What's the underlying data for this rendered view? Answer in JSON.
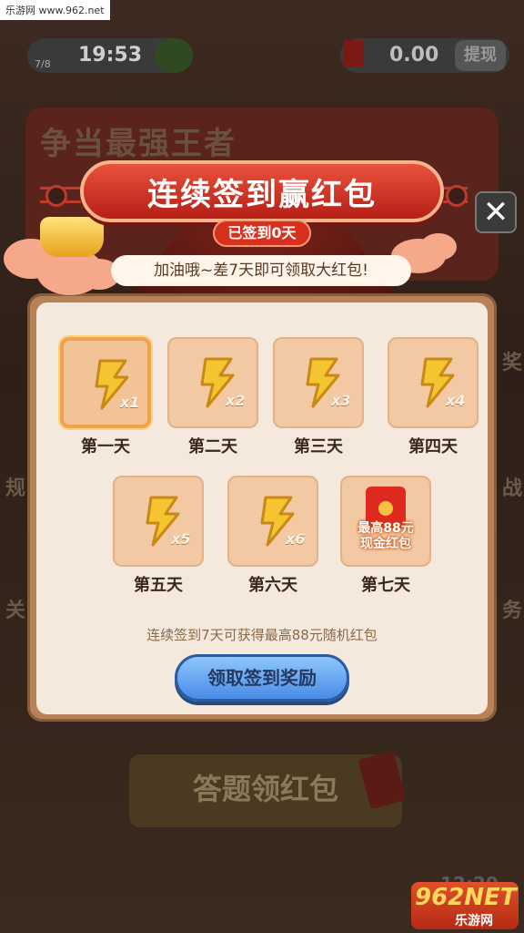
{
  "watermark": "乐游网 www.962.net",
  "topbar": {
    "energy_count": "7/8",
    "timer": "19:53",
    "plus_label": "+",
    "balance": "0.00",
    "withdraw_label": "提现"
  },
  "background": {
    "banner_title": "争当最强王者",
    "quiz_button_label": "答题领红包",
    "side_left_1": "规",
    "side_left_2": "关",
    "side_right_1": "奖",
    "side_right_2": "战",
    "side_right_3": "务",
    "bottom_number": "12:20"
  },
  "modal": {
    "title": "连续签到赢红包",
    "streak_badge": "已签到0天",
    "tip": "加油哦~差7天即可领取大红包!",
    "close_label": "✕",
    "days": [
      {
        "label": "第一天",
        "multiplier": "x1",
        "active": true
      },
      {
        "label": "第二天",
        "multiplier": "x2",
        "active": false
      },
      {
        "label": "第三天",
        "multiplier": "x3",
        "active": false
      },
      {
        "label": "第四天",
        "multiplier": "x4",
        "active": false
      },
      {
        "label": "第五天",
        "multiplier": "x5",
        "active": false
      },
      {
        "label": "第六天",
        "multiplier": "x6",
        "active": false
      },
      {
        "label": "第七天",
        "reward_line1": "最高88元",
        "reward_line2": "现金红包",
        "active": false
      }
    ],
    "hint": "连续签到7天可获得最高88元随机红包",
    "claim_button_label": "领取签到奖励"
  },
  "logo": {
    "top": "962NET",
    "bottom": "乐游网"
  },
  "colors": {
    "accent_red": "#d8301f",
    "card_bg": "#f2c9a2",
    "claim_blue": "#4a8be6"
  }
}
